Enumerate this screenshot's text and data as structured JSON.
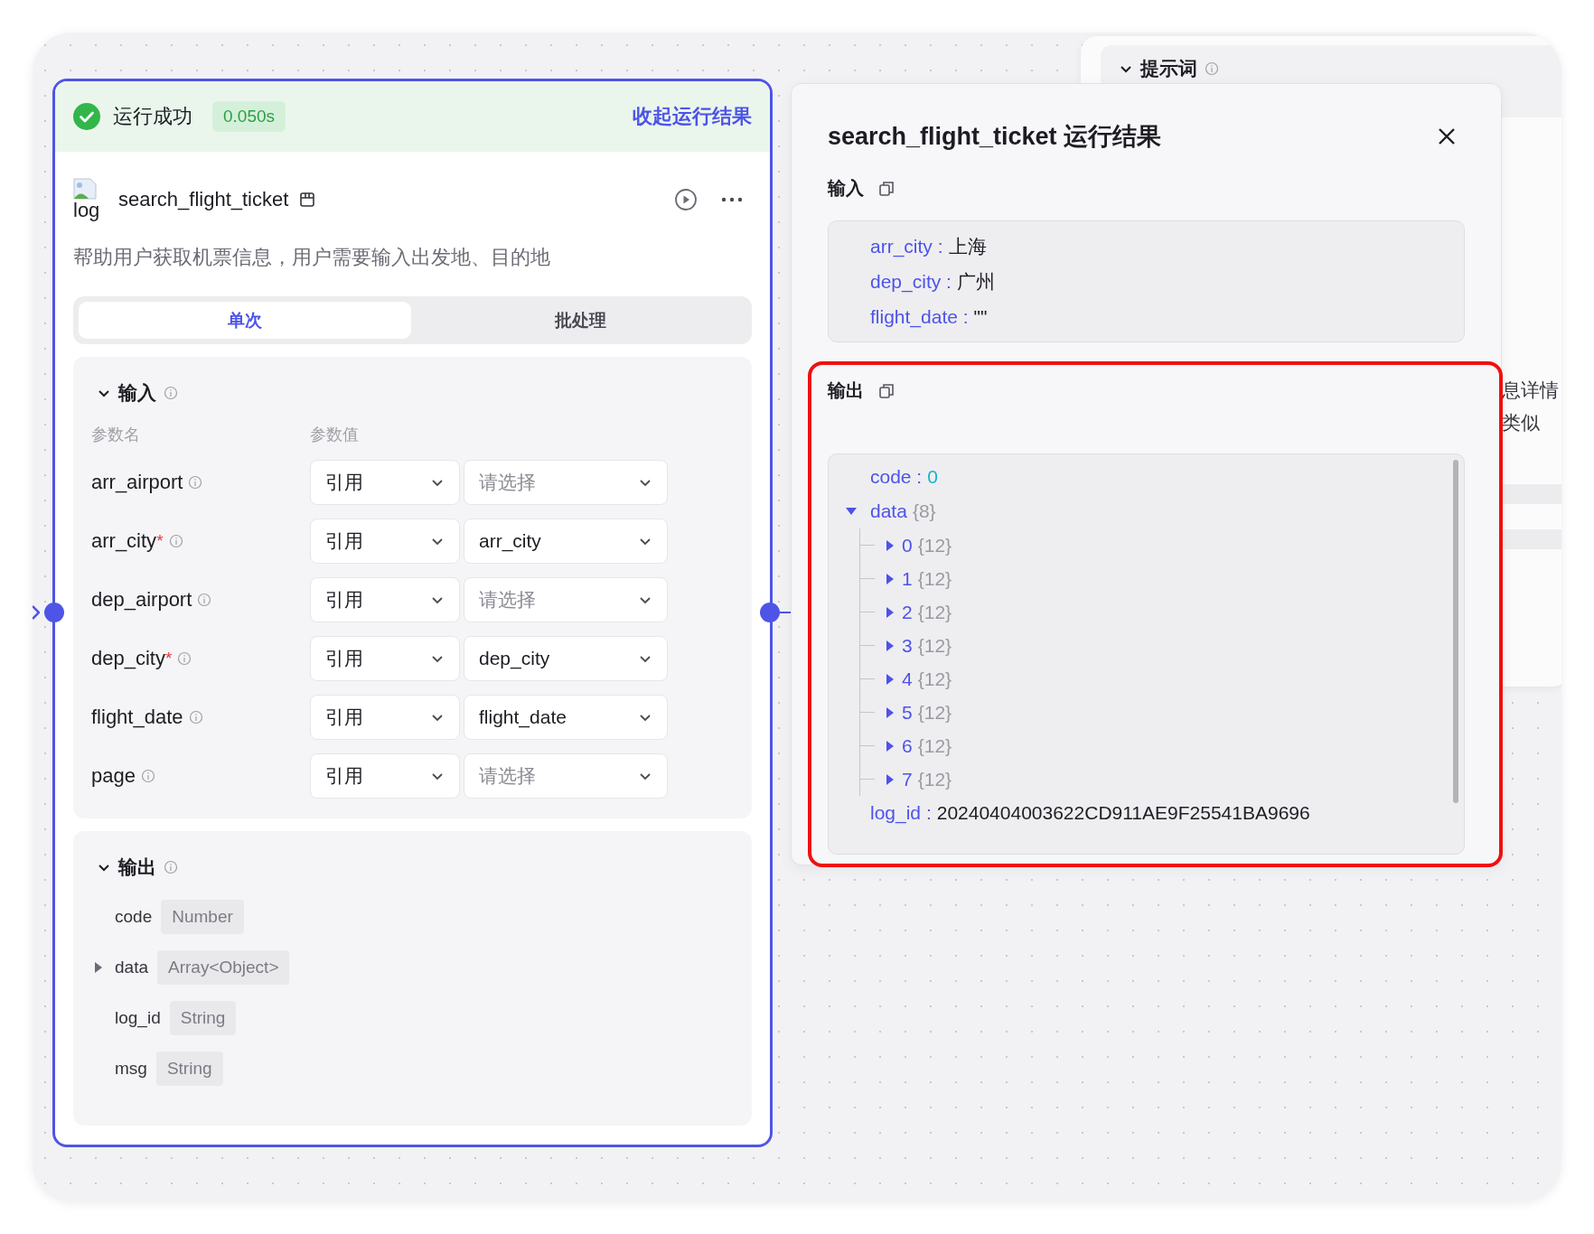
{
  "run_bar": {
    "status": "运行成功",
    "duration": "0.050s",
    "collapse_link": "收起运行结果"
  },
  "node": {
    "logo_alt": "log",
    "title": "search_flight_ticket",
    "description": "帮助用户获取机票信息，用户需要输入出发地、目的地",
    "tabs": [
      {
        "label": "单次",
        "selected": true
      },
      {
        "label": "批处理",
        "selected": false
      }
    ],
    "input": {
      "title": "输入",
      "expanded": true,
      "columns": [
        "参数名",
        "参数值"
      ],
      "required_mark": "*",
      "params": [
        {
          "name": "arr_airport",
          "required": false,
          "source": "引用",
          "placeholder": "请选择"
        },
        {
          "name": "arr_city",
          "required": true,
          "source": "引用",
          "value": "arr_city"
        },
        {
          "name": "dep_airport",
          "required": false,
          "source": "引用",
          "placeholder": "请选择"
        },
        {
          "name": "dep_city",
          "required": true,
          "source": "引用",
          "value": "dep_city"
        },
        {
          "name": "flight_date",
          "required": false,
          "source": "引用",
          "value": "flight_date"
        },
        {
          "name": "page",
          "required": false,
          "source": "引用",
          "placeholder": "请选择"
        }
      ]
    },
    "output": {
      "title": "输出",
      "expanded": true,
      "fields": [
        {
          "name": "code",
          "type": "Number",
          "expandable": false
        },
        {
          "name": "data",
          "type": "Array<Object>",
          "expandable": true
        },
        {
          "name": "log_id",
          "type": "String",
          "expandable": false
        },
        {
          "name": "msg",
          "type": "String",
          "expandable": false
        }
      ]
    }
  },
  "result_panel": {
    "title": "search_flight_ticket 运行结果",
    "separator": ":",
    "input": {
      "title": "输入",
      "entries": [
        {
          "key": "arr_city",
          "value": "上海"
        },
        {
          "key": "dep_city",
          "value": "广州"
        },
        {
          "key": "flight_date",
          "value": "\"\""
        }
      ]
    },
    "output": {
      "title": "输出",
      "tree": [
        {
          "key": "code",
          "value": "0",
          "kind": "number"
        },
        {
          "key": "data",
          "count": "{8}",
          "expanded": true,
          "children": [
            {
              "key": "0",
              "count": "{12}",
              "expanded": false
            },
            {
              "key": "1",
              "count": "{12}",
              "expanded": false
            },
            {
              "key": "2",
              "count": "{12}",
              "expanded": false
            },
            {
              "key": "3",
              "count": "{12}",
              "expanded": false
            },
            {
              "key": "4",
              "count": "{12}",
              "expanded": false
            },
            {
              "key": "5",
              "count": "{12}",
              "expanded": false
            },
            {
              "key": "6",
              "count": "{12}",
              "expanded": false
            },
            {
              "key": "7",
              "count": "{12}",
              "expanded": false
            }
          ]
        },
        {
          "key": "log_id",
          "value": "20240404003622CD911AE9F25541BA9696",
          "kind": "string"
        }
      ]
    }
  },
  "background_node": {
    "section_title": "提示词",
    "fragments": [
      "息详情",
      "类似"
    ]
  }
}
